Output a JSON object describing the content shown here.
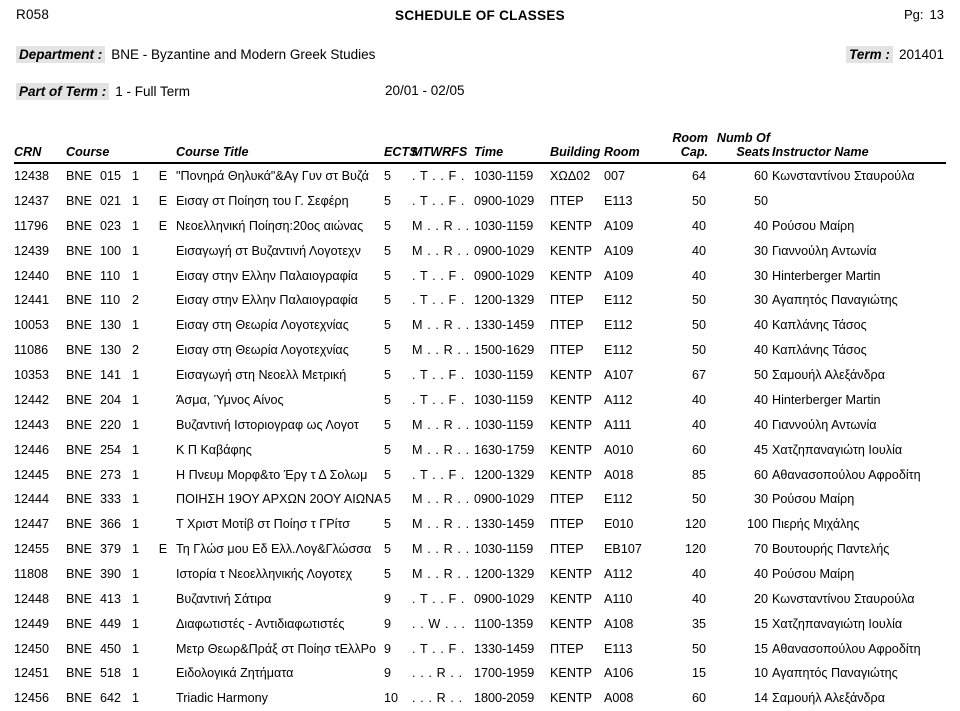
{
  "report": {
    "code": "R058",
    "title": "SCHEDULE OF CLASSES",
    "page_label": "Pg:",
    "page_number": "13"
  },
  "meta": {
    "department_label": "Department :",
    "department_value": "BNE - Byzantine and Modern Greek Studies",
    "term_label": "Term :",
    "term_value": "201401",
    "part_of_term_label": "Part of Term :",
    "part_of_term_value": "1 - Full Term",
    "part_of_term_dates": "20/01 - 02/05"
  },
  "table": {
    "headers": {
      "crn": "CRN",
      "course": "Course",
      "course_title": "Course Title",
      "ects": "ECTS",
      "mtwrfs": "MTWRFS",
      "time": "Time",
      "building": "Building",
      "room": "Room",
      "room_cap": "Room\nCap.",
      "numb_of_seats": "Numb Of\nSeats",
      "instructor_name": "Instructor Name"
    },
    "rows": [
      {
        "crn": "12438",
        "subject": "BNE",
        "number": "015",
        "section": "1",
        "eflag": "E",
        "title": "\"Πονηρά Θηλυκά\"&Αγ Γυν στ Βυζά",
        "ects": "5",
        "days": ". T . . F .",
        "time": "1030-1159",
        "building": "ΧΩΔ02",
        "room": "007",
        "cap": "64",
        "seats": "60",
        "instructor": "Κωνσταντίνου  Σταυρούλα"
      },
      {
        "crn": "12437",
        "subject": "BNE",
        "number": "021",
        "section": "1",
        "eflag": "E",
        "title": "Εισαγ στ Ποίηση του Γ. Σεφέρη",
        "ects": "5",
        "days": ". T . . F .",
        "time": "0900-1029",
        "building": "ΠΤΕΡ",
        "room": "E113",
        "cap": "50",
        "seats": "50",
        "instructor": ""
      },
      {
        "crn": "11796",
        "subject": "BNE",
        "number": "023",
        "section": "1",
        "eflag": "E",
        "title": "Νεοελληνική Ποίηση:20ος αιώνας",
        "ects": "5",
        "days": "M . . R . .",
        "time": "1030-1159",
        "building": "ΚΕΝΤΡ",
        "room": "A109",
        "cap": "40",
        "seats": "40",
        "instructor": "Ρούσου  Μαίρη"
      },
      {
        "crn": "12439",
        "subject": "BNE",
        "number": "100",
        "section": "1",
        "eflag": "",
        "title": "Εισαγωγή στ Βυζαντινή Λογοτεχν",
        "ects": "5",
        "days": "M . . R . .",
        "time": "0900-1029",
        "building": "ΚΕΝΤΡ",
        "room": "A109",
        "cap": "40",
        "seats": "30",
        "instructor": "Γιαννούλη  Αντωνία"
      },
      {
        "crn": "12440",
        "subject": "BNE",
        "number": "110",
        "section": "1",
        "eflag": "",
        "title": "Εισαγ στην Ελλην Παλαιογραφία",
        "ects": "5",
        "days": ". T . . F .",
        "time": "0900-1029",
        "building": "ΚΕΝΤΡ",
        "room": "A109",
        "cap": "40",
        "seats": "30",
        "instructor": "Hinterberger  Martin"
      },
      {
        "crn": "12441",
        "subject": "BNE",
        "number": "110",
        "section": "2",
        "eflag": "",
        "title": "Εισαγ στην Ελλην Παλαιογραφία",
        "ects": "5",
        "days": ". T . . F .",
        "time": "1200-1329",
        "building": "ΠΤΕΡ",
        "room": "E112",
        "cap": "50",
        "seats": "30",
        "instructor": "Αγαπητός  Παναγιώτης"
      },
      {
        "crn": "10053",
        "subject": "BNE",
        "number": "130",
        "section": "1",
        "eflag": "",
        "title": "Εισαγ στη Θεωρία Λογοτεχνίας",
        "ects": "5",
        "days": "M . . R . .",
        "time": "1330-1459",
        "building": "ΠΤΕΡ",
        "room": "E112",
        "cap": "50",
        "seats": "40",
        "instructor": "Καπλάνης  Τάσος"
      },
      {
        "crn": "11086",
        "subject": "BNE",
        "number": "130",
        "section": "2",
        "eflag": "",
        "title": "Εισαγ στη Θεωρία Λογοτεχνίας",
        "ects": "5",
        "days": "M . . R . .",
        "time": "1500-1629",
        "building": "ΠΤΕΡ",
        "room": "E112",
        "cap": "50",
        "seats": "40",
        "instructor": "Καπλάνης  Τάσος"
      },
      {
        "crn": "10353",
        "subject": "BNE",
        "number": "141",
        "section": "1",
        "eflag": "",
        "title": "Εισαγωγή στη Νεοελλ Μετρική",
        "ects": "5",
        "days": ". T . . F .",
        "time": "1030-1159",
        "building": "ΚΕΝΤΡ",
        "room": "A107",
        "cap": "67",
        "seats": "50",
        "instructor": "Σαμουήλ  Αλεξάνδρα"
      },
      {
        "crn": "12442",
        "subject": "BNE",
        "number": "204",
        "section": "1",
        "eflag": "",
        "title": "Άσμα, Ύμνος Αίνος",
        "ects": "5",
        "days": ". T . . F .",
        "time": "1030-1159",
        "building": "ΚΕΝΤΡ",
        "room": "A112",
        "cap": "40",
        "seats": "40",
        "instructor": "Hinterberger  Martin"
      },
      {
        "crn": "12443",
        "subject": "BNE",
        "number": "220",
        "section": "1",
        "eflag": "",
        "title": "Βυζαντινή Ιστοριογραφ ως Λογοτ",
        "ects": "5",
        "days": "M . . R . .",
        "time": "1030-1159",
        "building": "ΚΕΝΤΡ",
        "room": "A111",
        "cap": "40",
        "seats": "40",
        "instructor": "Γιαννούλη  Αντωνία"
      },
      {
        "crn": "12446",
        "subject": "BNE",
        "number": "254",
        "section": "1",
        "eflag": "",
        "title": "Κ Π Καβάφης",
        "ects": "5",
        "days": "M . . R . .",
        "time": "1630-1759",
        "building": "ΚΕΝΤΡ",
        "room": "A010",
        "cap": "60",
        "seats": "45",
        "instructor": "Χατζηπαναγιώτη  Ιουλία"
      },
      {
        "crn": "12445",
        "subject": "BNE",
        "number": "273",
        "section": "1",
        "eflag": "",
        "title": "Η Πνευμ Μορφ&το Έργ τ Δ Σολωμ",
        "ects": "5",
        "days": ". T . . F .",
        "time": "1200-1329",
        "building": "ΚΕΝΤΡ",
        "room": "A018",
        "cap": "85",
        "seats": "60",
        "instructor": "Αθανασοπούλου  Αφροδίτη"
      },
      {
        "crn": "12444",
        "subject": "BNE",
        "number": "333",
        "section": "1",
        "eflag": "",
        "title": "ΠΟΙΗΣΗ 19ΟΥ ΑΡΧΩΝ 20ΟΥ ΑΙΩΝΑ",
        "ects": "5",
        "days": "M . . R . .",
        "time": "0900-1029",
        "building": "ΠΤΕΡ",
        "room": "E112",
        "cap": "50",
        "seats": "30",
        "instructor": "Ρούσου  Μαίρη"
      },
      {
        "crn": "12447",
        "subject": "BNE",
        "number": "366",
        "section": "1",
        "eflag": "",
        "title": "Τ Χριστ Μοτίβ στ Ποίησ τ ΓΡίτσ",
        "ects": "5",
        "days": "M . . R . .",
        "time": "1330-1459",
        "building": "ΠΤΕΡ",
        "room": "E010",
        "cap": "120",
        "seats": "100",
        "instructor": "Πιερής  Μιχάλης"
      },
      {
        "crn": "12455",
        "subject": "BNE",
        "number": "379",
        "section": "1",
        "eflag": "E",
        "title": "Τη Γλώσ μου Εδ Ελλ.Λογ&Γλώσσα",
        "ects": "5",
        "days": "M . . R . .",
        "time": "1030-1159",
        "building": "ΠΤΕΡ",
        "room": "EB107",
        "cap": "120",
        "seats": "70",
        "instructor": "Βουτουρής  Παντελής"
      },
      {
        "crn": "11808",
        "subject": "BNE",
        "number": "390",
        "section": "1",
        "eflag": "",
        "title": "Ιστορία τ Νεοελληνικής Λογοτεχ",
        "ects": "5",
        "days": "M . . R . .",
        "time": "1200-1329",
        "building": "ΚΕΝΤΡ",
        "room": "A112",
        "cap": "40",
        "seats": "40",
        "instructor": "Ρούσου  Μαίρη"
      },
      {
        "crn": "12448",
        "subject": "BNE",
        "number": "413",
        "section": "1",
        "eflag": "",
        "title": "Βυζαντινή Σάτιρα",
        "ects": "9",
        "days": ". T . . F .",
        "time": "0900-1029",
        "building": "ΚΕΝΤΡ",
        "room": "A110",
        "cap": "40",
        "seats": "20",
        "instructor": "Κωνσταντίνου  Σταυρούλα"
      },
      {
        "crn": "12449",
        "subject": "BNE",
        "number": "449",
        "section": "1",
        "eflag": "",
        "title": "Διαφωτιστές - Αντιδιαφωτιστές",
        "ects": "9",
        "days": ". . W . . .",
        "time": "1100-1359",
        "building": "ΚΕΝΤΡ",
        "room": "A108",
        "cap": "35",
        "seats": "15",
        "instructor": "Χατζηπαναγιώτη  Ιουλία"
      },
      {
        "crn": "12450",
        "subject": "BNE",
        "number": "450",
        "section": "1",
        "eflag": "",
        "title": "Μετρ Θεωρ&Πράξ στ Ποίησ τΕλλΡο",
        "ects": "9",
        "days": ". T . . F .",
        "time": "1330-1459",
        "building": "ΠΤΕΡ",
        "room": "E113",
        "cap": "50",
        "seats": "15",
        "instructor": "Αθανασοπούλου  Αφροδίτη"
      },
      {
        "crn": "12451",
        "subject": "BNE",
        "number": "518",
        "section": "1",
        "eflag": "",
        "title": "Ειδολογικά Ζητήματα",
        "ects": "9",
        "days": ". . . R . .",
        "time": "1700-1959",
        "building": "ΚΕΝΤΡ",
        "room": "A106",
        "cap": "15",
        "seats": "10",
        "instructor": "Αγαπητός  Παναγιώτης"
      },
      {
        "crn": "12456",
        "subject": "BNE",
        "number": "642",
        "section": "1",
        "eflag": "",
        "title": "Triadic Harmony",
        "ects": "10",
        "days": ". . . R . .",
        "time": "1800-2059",
        "building": "ΚΕΝΤΡ",
        "room": "A008",
        "cap": "60",
        "seats": "14",
        "instructor": "Σαμουήλ  Αλεξάνδρα"
      }
    ]
  }
}
